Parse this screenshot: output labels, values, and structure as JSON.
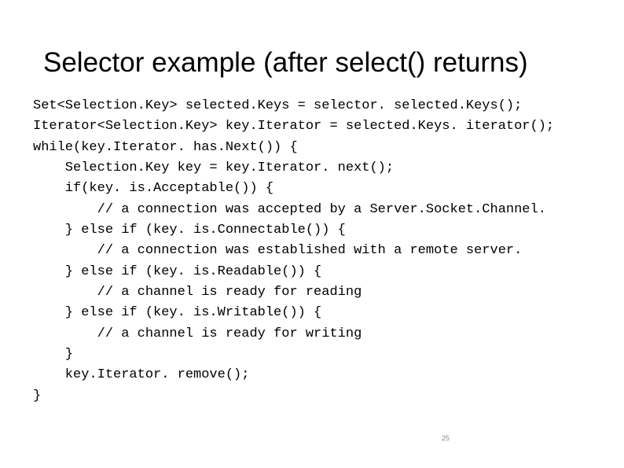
{
  "title": "Selector example (after select() returns)",
  "code_lines": [
    "Set<Selection.Key> selected.Keys = selector. selected.Keys();",
    "Iterator<Selection.Key> key.Iterator = selected.Keys. iterator();",
    "while(key.Iterator. has.Next()) {",
    "    Selection.Key key = key.Iterator. next();",
    "    if(key. is.Acceptable()) {",
    "        // a connection was accepted by a Server.Socket.Channel.",
    "    } else if (key. is.Connectable()) {",
    "        // a connection was established with a remote server.",
    "    } else if (key. is.Readable()) {",
    "        // a channel is ready for reading",
    "    } else if (key. is.Writable()) {",
    "        // a channel is ready for writing",
    "    }",
    "    key.Iterator. remove();",
    "}"
  ],
  "page_number": "25"
}
